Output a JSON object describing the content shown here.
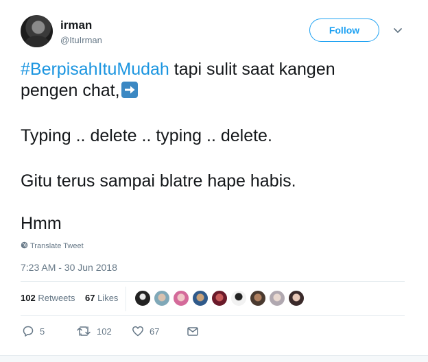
{
  "user": {
    "name": "irman",
    "handle": "@ItuIrman"
  },
  "follow_label": "Follow",
  "tweet": {
    "hashtag": "#BerpisahItuMudah",
    "line1_rest": " tapi sulit saat kangen",
    "line2": "pengen chat,",
    "emoji": "arrow-right-emoji",
    "line3": "Typing .. delete .. typing .. delete.",
    "line4": "Gitu terus sampai blatre hape habis.",
    "line5": "Hmm"
  },
  "translate_label": "Translate Tweet",
  "timestamp": "7:23 AM - 30 Jun 2018",
  "stats": {
    "retweets_count": "102",
    "retweets_label": "Retweets",
    "likes_count": "67",
    "likes_label": "Likes"
  },
  "actions": {
    "reply_count": "5",
    "retweet_count": "102",
    "like_count": "67"
  },
  "colors": {
    "accent": "#1da1f2",
    "hashtag": "#1b95e0",
    "muted": "#657786",
    "text": "#14171a"
  }
}
